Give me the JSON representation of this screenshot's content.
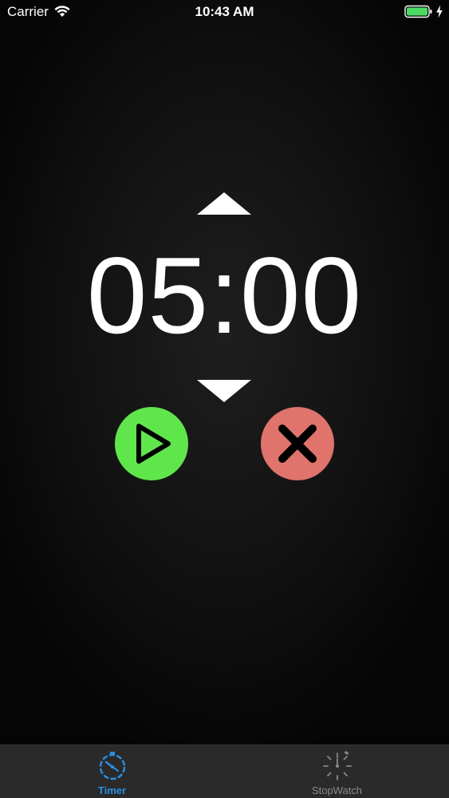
{
  "status_bar": {
    "carrier": "Carrier",
    "time": "10:43 AM",
    "battery_color": "#4cd964"
  },
  "timer": {
    "display": "05:00",
    "increment_icon": "triangle-up-icon",
    "decrement_icon": "triangle-down-icon",
    "start_button_color": "#5fe64b",
    "cancel_button_color": "#e0736b"
  },
  "tab_bar": {
    "active_color": "#2b8fe0",
    "inactive_color": "#8a8a8a",
    "tabs": [
      {
        "label": "Timer",
        "icon": "timer-icon",
        "active": true
      },
      {
        "label": "StopWatch",
        "icon": "stopwatch-icon",
        "active": false
      }
    ]
  }
}
